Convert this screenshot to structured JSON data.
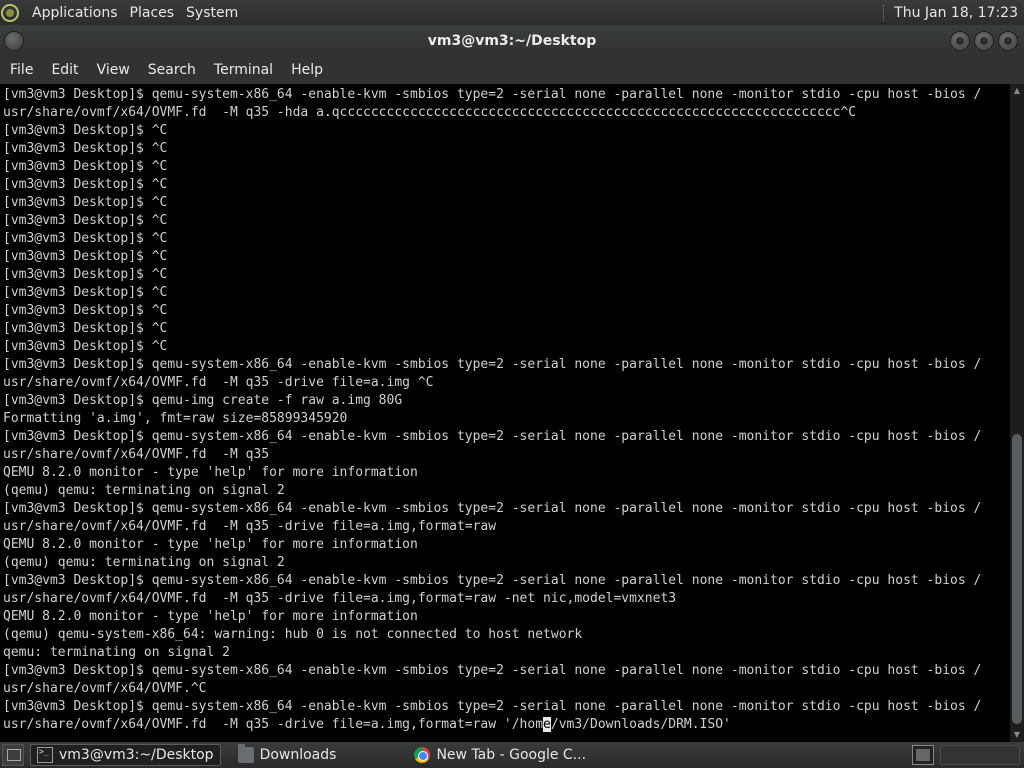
{
  "top_panel": {
    "menus": [
      "Applications",
      "Places",
      "System"
    ],
    "clock": "Thu Jan 18, 17:23"
  },
  "window": {
    "title": "vm3@vm3:~/Desktop"
  },
  "menu_bar": {
    "items": [
      "File",
      "Edit",
      "View",
      "Search",
      "Terminal",
      "Help"
    ]
  },
  "terminal": {
    "lines": [
      "[vm3@vm3 Desktop]$ qemu-system-x86_64 -enable-kvm -smbios type=2 -serial none -parallel none -monitor stdio -cpu host -bios /",
      "usr/share/ovmf/x64/OVMF.fd  -M q35 -hda a.qcccccccccccccccccccccccccccccccccccccccccccccccccccccccccccccccc^C",
      "[vm3@vm3 Desktop]$ ^C",
      "[vm3@vm3 Desktop]$ ^C",
      "[vm3@vm3 Desktop]$ ^C",
      "[vm3@vm3 Desktop]$ ^C",
      "[vm3@vm3 Desktop]$ ^C",
      "[vm3@vm3 Desktop]$ ^C",
      "[vm3@vm3 Desktop]$ ^C",
      "[vm3@vm3 Desktop]$ ^C",
      "[vm3@vm3 Desktop]$ ^C",
      "[vm3@vm3 Desktop]$ ^C",
      "[vm3@vm3 Desktop]$ ^C",
      "[vm3@vm3 Desktop]$ ^C",
      "[vm3@vm3 Desktop]$ ^C",
      "[vm3@vm3 Desktop]$ qemu-system-x86_64 -enable-kvm -smbios type=2 -serial none -parallel none -monitor stdio -cpu host -bios /",
      "usr/share/ovmf/x64/OVMF.fd  -M q35 -drive file=a.img ^C",
      "[vm3@vm3 Desktop]$ qemu-img create -f raw a.img 80G",
      "Formatting 'a.img', fmt=raw size=85899345920",
      "[vm3@vm3 Desktop]$ qemu-system-x86_64 -enable-kvm -smbios type=2 -serial none -parallel none -monitor stdio -cpu host -bios /",
      "usr/share/ovmf/x64/OVMF.fd  -M q35",
      "QEMU 8.2.0 monitor - type 'help' for more information",
      "(qemu) qemu: terminating on signal 2",
      "[vm3@vm3 Desktop]$ qemu-system-x86_64 -enable-kvm -smbios type=2 -serial none -parallel none -monitor stdio -cpu host -bios /",
      "usr/share/ovmf/x64/OVMF.fd  -M q35 -drive file=a.img,format=raw",
      "QEMU 8.2.0 monitor - type 'help' for more information",
      "(qemu) qemu: terminating on signal 2",
      "[vm3@vm3 Desktop]$ qemu-system-x86_64 -enable-kvm -smbios type=2 -serial none -parallel none -monitor stdio -cpu host -bios /",
      "usr/share/ovmf/x64/OVMF.fd  -M q35 -drive file=a.img,format=raw -net nic,model=vmxnet3",
      "QEMU 8.2.0 monitor - type 'help' for more information",
      "(qemu) qemu-system-x86_64: warning: hub 0 is not connected to host network",
      "qemu: terminating on signal 2",
      "[vm3@vm3 Desktop]$ qemu-system-x86_64 -enable-kvm -smbios type=2 -serial none -parallel none -monitor stdio -cpu host -bios /",
      "usr/share/ovmf/x64/OVMF.^C",
      "[vm3@vm3 Desktop]$ qemu-system-x86_64 -enable-kvm -smbios type=2 -serial none -parallel none -monitor stdio -cpu host -bios /"
    ],
    "last_line_before_cursor": "usr/share/ovmf/x64/OVMF.fd  -M q35 -drive file=a.img,format=raw '/hom",
    "cursor_char": "e",
    "last_line_after_cursor": "/vm3/Downloads/DRM.ISO'"
  },
  "taskbar": {
    "tasks": [
      "vm3@vm3:~/Desktop",
      "Downloads",
      "New Tab - Google C..."
    ]
  }
}
